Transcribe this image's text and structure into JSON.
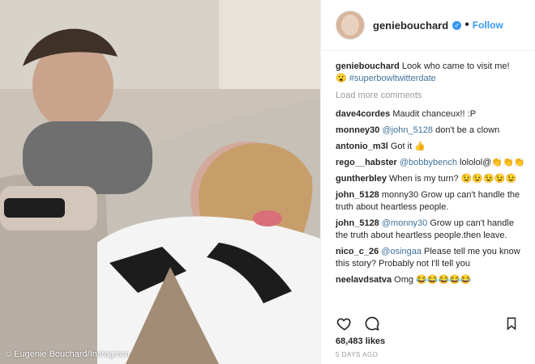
{
  "header": {
    "username": "geniebouchard",
    "follow_label": "Follow",
    "dot": "•"
  },
  "post": {
    "author": "geniebouchard",
    "caption": "Look who came to visit me!",
    "emoji": "😮",
    "hashtag": "#superbowltwitterdate",
    "load_more": "Load more comments"
  },
  "comments": [
    {
      "user": "dave4cordes",
      "text": "Maudit chanceux!! :P"
    },
    {
      "user": "monney30",
      "mention": "@john_5128",
      "text": " don't be a clown"
    },
    {
      "user": "antonio_m3l",
      "text": "Got it 👍"
    },
    {
      "user": "rego__habster",
      "mention": "@bobbybench",
      "text": " lololol@👏👏👏"
    },
    {
      "user": "guntherbley",
      "text": "When is my turn? 😉😉😉😉😉"
    },
    {
      "user": "john_5128",
      "text": "monny30 Grow up can't handle the truth about heartless people."
    },
    {
      "user": "john_5128",
      "mention": "@monny30",
      "text": " Grow up can't handle the truth about heartless people.then leave."
    },
    {
      "user": "nico_c_26",
      "mention": "@osingaa",
      "text": " Please tell me you know this story? Probably not I'll tell you"
    },
    {
      "user": "neelavdsatva",
      "text": "Omg 😂😂😂😂😂"
    }
  ],
  "likes": "68,483 likes",
  "time": "5 DAYS AGO",
  "photo_credit": "© Eugenie Bouchard/Instagram",
  "icons": {
    "heart": "heart-icon",
    "comment": "comment-icon",
    "bookmark": "bookmark-icon",
    "verified": "verified-icon"
  },
  "colors": {
    "link": "#3897f0",
    "mention": "#3f729b"
  }
}
